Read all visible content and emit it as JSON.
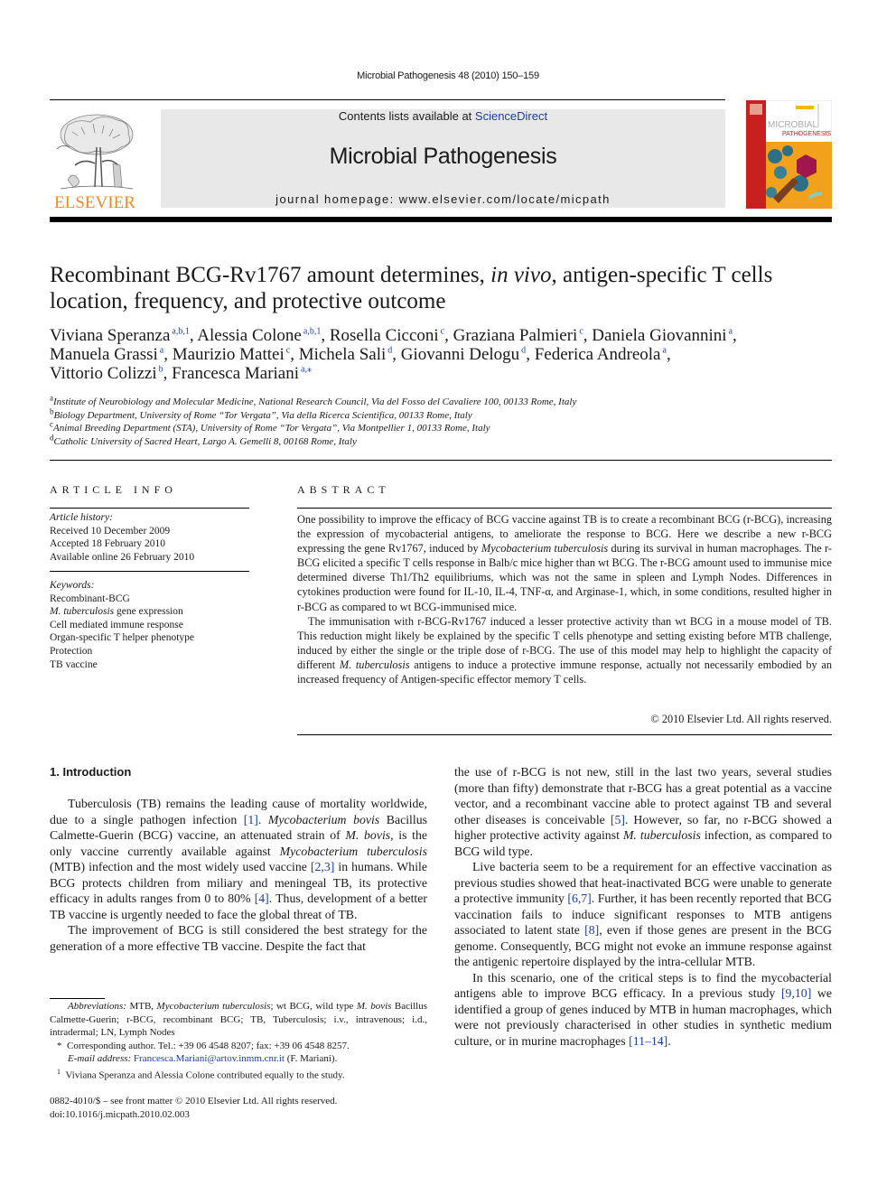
{
  "running_head": "Microbial Pathogenesis 48 (2010) 150–159",
  "header": {
    "publisher_logo": "elsevier-tree-logo",
    "publisher_name": "ELSEVIER",
    "contents_prefix": "Contents lists available at ",
    "contents_link": "ScienceDirect",
    "journal_title": "Microbial Pathogenesis",
    "homepage": "journal homepage: www.elsevier.com/locate/micpath",
    "cover_title_line1": "MICROBIAL",
    "cover_title_line2": "PATHOGENESIS",
    "colors": {
      "elsevier_orange": "#f08a1c",
      "link_blue": "#1a3ea0",
      "banner_gray": "#e8e8e8",
      "cover_red": "#c8201e"
    }
  },
  "article": {
    "title_part1": "Recombinant BCG-Rv1767 amount determines, ",
    "title_italic": "in vivo",
    "title_part2": ", antigen-specific T cells location, frequency, and protective outcome",
    "authors": [
      {
        "name": "Viviana Speranza",
        "aff": "a,b,1",
        "sep": ", "
      },
      {
        "name": "Alessia Colone",
        "aff": "a,b,1",
        "sep": ", "
      },
      {
        "name": "Rosella Cicconi",
        "aff": "c",
        "sep": ", "
      },
      {
        "name": "Graziana Palmieri",
        "aff": "c",
        "sep": ", "
      },
      {
        "name": "Daniela Giovannini",
        "aff": "a",
        "sep": ","
      },
      {
        "name": "Manuela Grassi",
        "aff": "a",
        "sep": ", "
      },
      {
        "name": "Maurizio Mattei",
        "aff": "c",
        "sep": ", "
      },
      {
        "name": "Michela Sali",
        "aff": "d",
        "sep": ", "
      },
      {
        "name": "Giovanni Delogu",
        "aff": "d",
        "sep": ", "
      },
      {
        "name": "Federica Andreola",
        "aff": "a",
        "sep": ","
      },
      {
        "name": "Vittorio Colizzi",
        "aff": "b",
        "sep": ", "
      },
      {
        "name": "Francesca Mariani",
        "aff": "a,⁎",
        "sep": ""
      }
    ],
    "affiliations": [
      {
        "letter": "a",
        "text": "Institute of Neurobiology and Molecular Medicine, National Research Council, Via del Fosso del Cavaliere 100, 00133 Rome, Italy"
      },
      {
        "letter": "b",
        "text": "Biology Department, University of Rome “Tor Vergata”, Via della Ricerca Scientifica, 00133 Rome, Italy"
      },
      {
        "letter": "c",
        "text": "Animal Breeding Department (STA), University of Rome “Tor Vergata”, Via Montpellier 1, 00133 Rome, Italy"
      },
      {
        "letter": "d",
        "text": "Catholic University of Sacred Heart, Largo A. Gemelli 8, 00168 Rome, Italy"
      }
    ]
  },
  "article_info": {
    "heading": "ARTICLE INFO",
    "history_label": "Article history:",
    "history": [
      "Received 10 December 2009",
      "Accepted 18 February 2010",
      "Available online 26 February 2010"
    ],
    "keywords_label": "Keywords:",
    "keywords": [
      {
        "italic": "",
        "text": "Recombinant-BCG"
      },
      {
        "italic": "M. tuberculosis",
        "text": " gene expression"
      },
      {
        "italic": "",
        "text": "Cell mediated immune response"
      },
      {
        "italic": "",
        "text": "Organ-specific T helper phenotype"
      },
      {
        "italic": "",
        "text": "Protection"
      },
      {
        "italic": "",
        "text": "TB vaccine"
      }
    ]
  },
  "abstract": {
    "heading": "ABSTRACT",
    "p1_a": "One possibility to improve the efficacy of BCG vaccine against TB is to create a recombinant BCG (r-BCG), increasing the expression of mycobacterial antigens, to ameliorate the response to BCG. Here we describe a new r-BCG expressing the gene Rv1767, induced by ",
    "p1_i": "Mycobacterium tuberculosis",
    "p1_b": " during its survival in human macrophages. The r-BCG elicited a specific T cells response in Balb/c mice higher than wt BCG. The r-BCG amount used to immunise mice determined diverse Th1/Th2 equilibriums, which was not the same in spleen and Lymph Nodes. Differences in cytokines production were found for IL-10, IL-4, TNF-α, and Arginase-1, which, in some conditions, resulted higher in r-BCG as compared to wt BCG-immunised mice.",
    "p2_a": "The immunisation with r-BCG-Rv1767 induced a lesser protective activity than wt BCG in a mouse model of TB. This reduction might likely be explained by the specific T cells phenotype and setting existing before MTB challenge, induced by either the single or the triple dose of r-BCG. The use of this model may help to highlight the capacity of different ",
    "p2_i": "M. tuberculosis",
    "p2_b": " antigens to induce a protective immune response, actually not necessarily embodied by an increased frequency of Antigen-specific effector memory T cells.",
    "copyright": "© 2010 Elsevier Ltd. All rights reserved."
  },
  "intro": {
    "heading": "1.  Introduction",
    "left": {
      "p1": [
        {
          "t": "Tuberculosis (TB) remains the leading cause of mortality worldwide, due to a single pathogen infection "
        },
        {
          "l": "[1]"
        },
        {
          "t": ". "
        },
        {
          "i": "Mycobacterium bovis"
        },
        {
          "t": " Bacillus Calmette-Guerin (BCG) vaccine, an attenuated strain of "
        },
        {
          "i": "M. bovis"
        },
        {
          "t": ", is the only vaccine currently available against "
        },
        {
          "i": "Myco­bacterium tuberculosis"
        },
        {
          "t": " (MTB) infection and the most widely used vaccine "
        },
        {
          "l": "[2,3]"
        },
        {
          "t": " in humans. While BCG protects children from miliary and meningeal TB, its protective efficacy in adults ranges from 0 to 80% "
        },
        {
          "l": "[4]"
        },
        {
          "t": ". Thus, development of a better TB vaccine is urgently needed to face the global threat of TB."
        }
      ],
      "p2": [
        {
          "t": "The improvement of BCG is still considered the best strategy for the generation of a more effective TB vaccine. Despite the fact that"
        }
      ]
    },
    "right": {
      "p0": [
        {
          "t": "the use of r-BCG is not new, still in the last two years, several studies (more than fifty) demonstrate that r-BCG has a great potential as a vaccine vector, and a recombinant vaccine able to protect against TB and several other diseases is conceivable "
        },
        {
          "l": "[5]"
        },
        {
          "t": ". However, so far, no r-BCG showed a higher protective activity against "
        },
        {
          "i": "M. tuberculosis"
        },
        {
          "t": " infection, as compared to BCG wild type."
        }
      ],
      "p1": [
        {
          "t": "Live bacteria seem to be a requirement for an effective vacci­nation as previous studies showed that heat-inactivated BCG were unable to generate a protective immunity "
        },
        {
          "l": "[6,7]"
        },
        {
          "t": ". Further, it has been recently reported that BCG vaccination fails to induce significant responses to MTB antigens associated to latent state "
        },
        {
          "l": "[8]"
        },
        {
          "t": ", even if those genes are present in the BCG genome. Consequently, BCG might not evoke an immune response against the antigenic repertoire displayed by the intra-cellular MTB."
        }
      ],
      "p2": [
        {
          "t": "In this scenario, one of the critical steps is to find the myco­bacterial antigens able to improve BCG efficacy. In a previous study "
        },
        {
          "l": "[9,10]"
        },
        {
          "t": " we identified a group of genes induced by MTB in human macrophages, which were not previously characterised in other studies in synthetic medium culture, or in murine macrophages "
        },
        {
          "l": "[11–14]"
        },
        {
          "t": "."
        }
      ]
    }
  },
  "footnotes": {
    "abbrev_label": "Abbreviations:",
    "abbrev": [
      {
        "t": " MTB, "
      },
      {
        "i": "Mycobacterium tuberculosis"
      },
      {
        "t": "; wt BCG, wild type "
      },
      {
        "i": "M. bovis"
      },
      {
        "t": " Bacillus Calmette-Guerin; r-BCG, recombinant BCG; TB, Tuberculosis; i.v., intrave­nous; i.d., intradermal; LN, Lymph Nodes"
      }
    ],
    "corresponding_mark": "*",
    "corresponding": "Corresponding author. Tel.: +39 06 4548 8207; fax: +39 06 4548 8257.",
    "email_label": "E-mail address:",
    "email": "Francesca.Mariani@artov.inmm.cnr.it",
    "email_suffix": " (F. Mariani).",
    "equal_mark": "1",
    "equal": "Viviana Speranza and Alessia Colone contributed equally to the study."
  },
  "front_matter": {
    "issn_line": "0882-4010/$ – see front matter © 2010 Elsevier Ltd. All rights reserved.",
    "doi": "doi:10.1016/j.micpath.2010.02.003"
  }
}
